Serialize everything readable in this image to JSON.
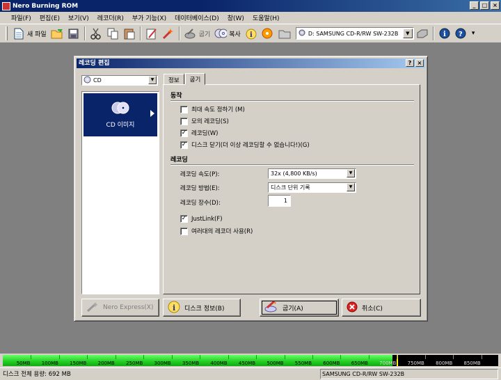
{
  "window": {
    "title": "Nero Burning ROM"
  },
  "menu": [
    "파일(F)",
    "편집(E)",
    "보기(V)",
    "레코더(R)",
    "부가 기능(X)",
    "데이터베이스(D)",
    "창(W)",
    "도움말(H)"
  ],
  "toolbar": {
    "new_label": "새 파일",
    "burn_label": "굽기",
    "copy_label": "복사",
    "drive_value": "D: SAMSUNG CD-R/RW SW-232B"
  },
  "dialog": {
    "title": "레코딩 편집",
    "media_value": "CD",
    "left_item_label": "CD 이미지",
    "tabs": [
      "정보",
      "굽기"
    ],
    "section_action": "동작",
    "checks": [
      {
        "label": "최대 속도 정하기 (M)",
        "checked": false
      },
      {
        "label": "모의 레코딩(S)",
        "checked": false
      },
      {
        "label": "레코딩(W)",
        "checked": true
      },
      {
        "label": "디스크 닫기(더 이상 레코딩할 수 없습니다!)(G)",
        "checked": true
      }
    ],
    "section_recording": "레코딩",
    "speed_label": "레코딩 속도(P):",
    "speed_value": "32x (4,800 KB/s)",
    "method_label": "레코딩 방법(E):",
    "method_value": "디스크 단위 기록",
    "copies_label": "레코딩 장수(D):",
    "copies_value": "1",
    "justlink": {
      "label": "JustLink(F)",
      "checked": true
    },
    "multi_recorder": {
      "label": "여러대의 레코더 사용(R)",
      "checked": false
    },
    "buttons": {
      "nero_express": "Nero Express(X)",
      "disc_info": "디스크 정보(B)",
      "burn": "굽기(A)",
      "cancel": "취소(C)"
    }
  },
  "capacity": {
    "ticks": [
      "50MB",
      "100MB",
      "150MB",
      "200MB",
      "250MB",
      "300MB",
      "350MB",
      "400MB",
      "450MB",
      "500MB",
      "550MB",
      "600MB",
      "650MB",
      "700MB",
      "750MB",
      "800MB",
      "850MB"
    ],
    "used_mb": 692,
    "max_mb": 880
  },
  "status": {
    "left": "디스크 전체 용량: 692 MB",
    "right": "SAMSUNG  CD-R/RW SW-232B"
  },
  "colors": {
    "title": "#0a246a",
    "capacity_green": "#22cc22",
    "capacity_limit": "#ffff00"
  }
}
